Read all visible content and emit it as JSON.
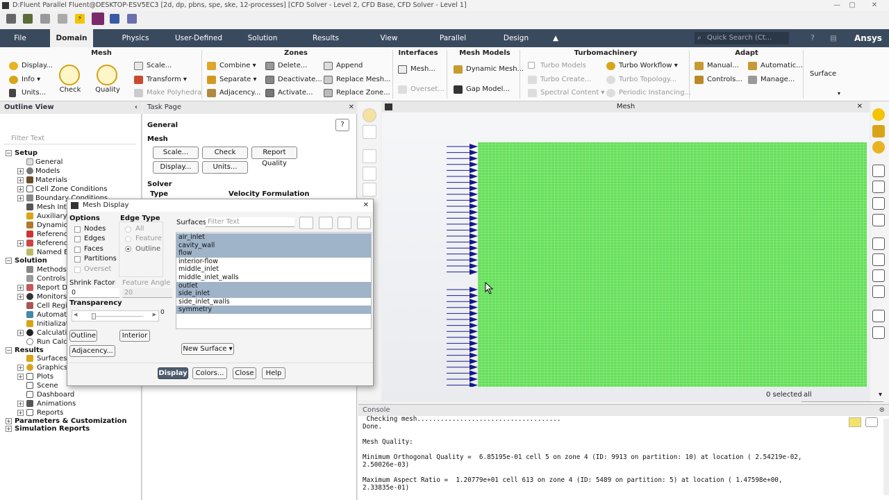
{
  "window": {
    "title": "D:Fluent Parallel Fluent@DESKTOP-ESV5EC3  [2d, dp, pbns, spe, ske, 12-processes] [CFD Solver - Level 2, CFD Base, CFD Solver - Level 1]"
  },
  "menubar": {
    "items": [
      "File",
      "Domain",
      "Physics",
      "User-Defined",
      "Solution",
      "Results",
      "View",
      "Parallel",
      "Design"
    ],
    "active": "Domain",
    "search_placeholder": "Quick Search (Ct...",
    "brand": "Ansys"
  },
  "ribbon": {
    "mesh": {
      "title": "Mesh",
      "display": "Display...",
      "info": "Info",
      "units": "Units...",
      "check": "Check",
      "quality": "Quality",
      "scale": "Scale...",
      "transform": "Transform",
      "make_polyhedra": "Make Polyhedra"
    },
    "zones": {
      "title": "Zones",
      "combine": "Combine",
      "separate": "Separate",
      "adjacency": "Adjacency...",
      "delete": "Delete...",
      "deactivate": "Deactivate...",
      "activate": "Activate...",
      "append": "Append",
      "replace_mesh": "Replace Mesh...",
      "replace_zone": "Replace Zone..."
    },
    "interfaces": {
      "title": "Interfaces",
      "mesh": "Mesh...",
      "overset": "Overset..."
    },
    "mesh_models": {
      "title": "Mesh Models",
      "dynamic_mesh": "Dynamic Mesh...",
      "gap_model": "Gap Model..."
    },
    "turbo": {
      "title": "Turbomachinery",
      "turbo_models": "Turbo Models",
      "turbo_create": "Turbo Create...",
      "spectral": "Spectral Content",
      "turbo_workflow": "Turbo Workflow",
      "turbo_topology": "Turbo Topology...",
      "periodic": "Periodic Instancing..."
    },
    "adapt": {
      "title": "Adapt",
      "manual": "Manual...",
      "controls": "Controls...",
      "automatic": "Automatic...",
      "manage": "Manage..."
    },
    "surface": "Surface"
  },
  "outline": {
    "title": "Outline View",
    "filter": "Filter Text",
    "setup": "Setup",
    "setup_items": [
      "General",
      "Models",
      "Materials",
      "Cell Zone Conditions",
      "Boundary Conditions",
      "Mesh Inte",
      "Auxiliary G",
      "Dynamic M",
      "Reference",
      "Reference",
      "Named Ex"
    ],
    "solution": "Solution",
    "solution_items": [
      "Methods",
      "Controls",
      "Report De",
      "Monitors",
      "Cell Regis",
      "Automatio",
      "Initializati",
      "Calculation",
      "Run Calcu"
    ],
    "results": "Results",
    "results_items": [
      "Surfaces",
      "Graphics",
      "Plots",
      "Scene",
      "Dashboard",
      "Animations",
      "Reports"
    ],
    "params": "Parameters & Customization",
    "sim_reports": "Simulation Reports"
  },
  "taskpage": {
    "title": "Task Page",
    "heading": "General",
    "mesh_label": "Mesh",
    "scale": "Scale...",
    "check": "Check",
    "report_quality": "Report Quality",
    "display": "Display...",
    "units": "Units...",
    "solver": "Solver",
    "type": "Type",
    "velocity": "Velocity Formulation"
  },
  "viewport": {
    "title": "Mesh",
    "selected": "0 selected",
    "filter": "all"
  },
  "console": {
    "title": "Console",
    "lines": [
      " Checking mesh.....................................",
      "Done.",
      "",
      "Mesh Quality:",
      "",
      "Minimum Orthogonal Quality =  6.85195e-01 cell 5 on zone 4 (ID: 9913 on partition: 10) at location ( 2.54219e-02,",
      "2.50026e-03)",
      "",
      "Maximum Aspect Ratio =  1.20779e+01 cell 613 on zone 4 (ID: 5489 on partition: 5) at location ( 1.47598e+00,",
      "2.33835e-01)"
    ]
  },
  "dialog": {
    "title": "Mesh Display",
    "options": "Options",
    "nodes": "Nodes",
    "edges": "Edges",
    "faces": "Faces",
    "partitions": "Partitions",
    "overset": "Overset",
    "edge_type": "Edge Type",
    "all": "All",
    "feature": "Feature",
    "outline": "Outline",
    "surfaces": "Surfaces",
    "filter_placeholder": "Filter Text",
    "surface_items": [
      {
        "name": "air_inlet",
        "selected": true
      },
      {
        "name": "cavity_wall",
        "selected": true
      },
      {
        "name": "flow",
        "selected": true
      },
      {
        "name": "interior-flow",
        "selected": false
      },
      {
        "name": "middle_inlet",
        "selected": false
      },
      {
        "name": "middle_inlet_walls",
        "selected": false
      },
      {
        "name": "outlet",
        "selected": true
      },
      {
        "name": "side_inlet",
        "selected": true
      },
      {
        "name": "side_inlet_walls",
        "selected": false
      },
      {
        "name": "symmetry",
        "selected": true
      }
    ],
    "shrink_factor": "Shrink Factor",
    "shrink_value": "0",
    "feature_angle": "Feature Angle",
    "feature_value": "20",
    "transparency": "Transparency",
    "transparency_value": "0",
    "outline_btn": "Outline",
    "interior_btn": "Interior",
    "adjacency_btn": "Adjacency...",
    "new_surface": "New Surface",
    "display_btn": "Display",
    "colors_btn": "Colors...",
    "close_btn": "Close",
    "help_btn": "Help"
  }
}
